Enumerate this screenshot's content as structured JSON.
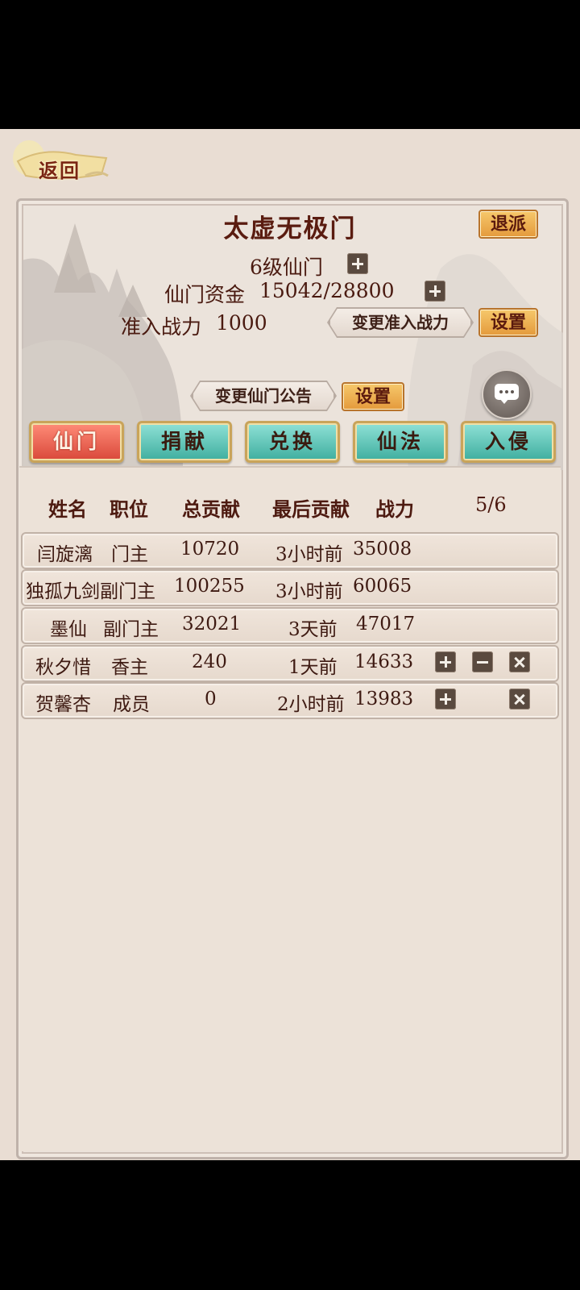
{
  "back_label": "返回",
  "sect": {
    "name": "太虚无极门",
    "leave_label": "退派",
    "level_text": "6级仙门",
    "funds_label": "仙门资金",
    "funds_value": "15042/28800",
    "power_label": "准入战力",
    "power_value": "1000",
    "change_power_label": "变更准入战力",
    "set_label": "设置",
    "change_notice_label": "变更仙门公告",
    "set_label2": "设置"
  },
  "tabs": [
    "仙门",
    "捐献",
    "兑换",
    "仙法",
    "入侵"
  ],
  "table": {
    "headers": {
      "name": "姓名",
      "role": "职位",
      "total": "总贡献",
      "last": "最后贡献",
      "power": "战力",
      "count": "5/6"
    },
    "rows": [
      {
        "name": "闫旋漓",
        "role": "门主",
        "total": "10720",
        "last": "3小时前",
        "power": "35008",
        "actions": []
      },
      {
        "name": "独孤九剑",
        "role": "副门主",
        "total": "100255",
        "last": "3小时前",
        "power": "60065",
        "actions": []
      },
      {
        "name": "墨仙",
        "role": "副门主",
        "total": "32021",
        "last": "3天前",
        "power": "47017",
        "actions": []
      },
      {
        "name": "秋夕惜",
        "role": "香主",
        "total": "240",
        "last": "1天前",
        "power": "14633",
        "actions": [
          "plus",
          "minus",
          "remove"
        ]
      },
      {
        "name": "贺馨杏",
        "role": "成员",
        "total": "0",
        "last": "2小时前",
        "power": "13983",
        "actions": [
          "plus",
          "remove"
        ]
      }
    ]
  }
}
